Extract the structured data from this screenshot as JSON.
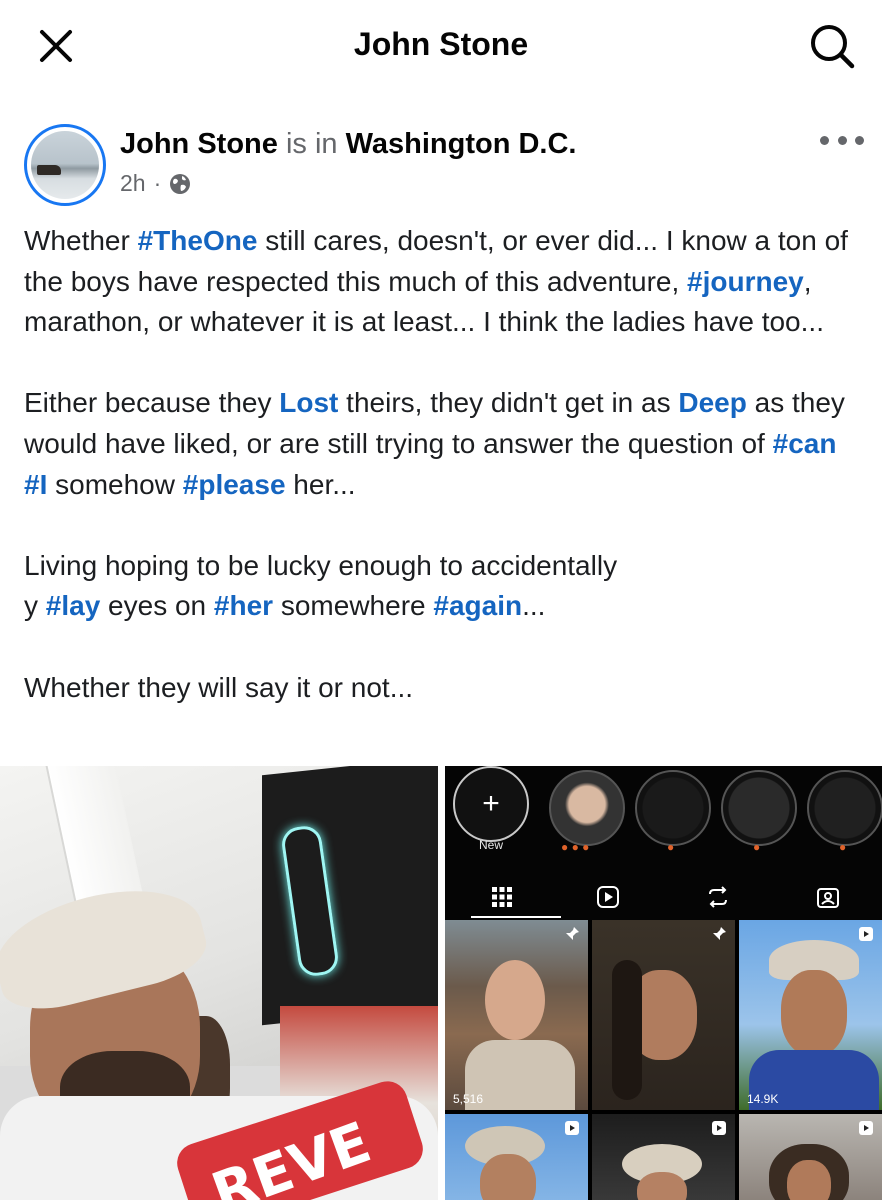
{
  "header": {
    "title": "John Stone"
  },
  "post": {
    "author": "John Stone",
    "connector": "is in",
    "location": "Washington D.C.",
    "time": "2h",
    "separator": "·"
  },
  "text": {
    "p1": {
      "a": "Whether ",
      "tag1": "#TheOne",
      "b": " still cares, doesn't, or ever did... I know a ton of the boys have respected this much of this adventure, ",
      "tag2": "#journey",
      "c": ", marathon, or whatever it is at least... I think the ladies have too..."
    },
    "p2": {
      "a": "Either because they ",
      "tag1": "Lost",
      "b": " theirs, they didn't get in as ",
      "tag2": "Deep",
      "c": " as they would have liked, or are still trying to answer the question of ",
      "tag3": "#can",
      "d": " ",
      "tag4": "#I",
      "e": " somehow ",
      "tag5": "#please",
      "f": " her..."
    },
    "p3": {
      "a": "Living hoping to be lucky enough to accidentally",
      "b": "y ",
      "tag1": "#lay",
      "c": " eyes on ",
      "tag2": "#her",
      "d": " somewhere ",
      "tag3": "#again",
      "e": "..."
    },
    "p4": "Whether they will say it or not..."
  },
  "photos": {
    "left": {
      "jacket_text": "REVE"
    },
    "right": {
      "new_label": "New",
      "new_plus": "+",
      "views_1": "5,516",
      "views_2": "14.9K"
    }
  },
  "colors": {
    "hashtag": "#1565c0",
    "avatar_ring": "#1877f2",
    "muted": "#65676b"
  }
}
